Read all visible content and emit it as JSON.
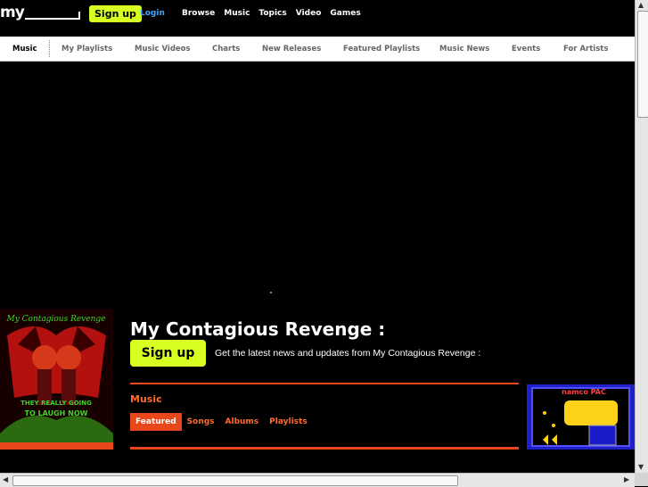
{
  "header": {
    "logo_text": "my",
    "signup_label": "Sign up",
    "login_label": "Login",
    "nav": [
      "Browse",
      "Music",
      "Topics",
      "Video",
      "Games"
    ]
  },
  "subnav": {
    "items": [
      "Music",
      "My Playlists",
      "Music Videos",
      "Charts",
      "New Releases",
      "Featured Playlists",
      "Music News",
      "Events",
      "For Artists"
    ],
    "active": "Music"
  },
  "profile": {
    "artwork_text": [
      "My Contagious Revenge",
      "THEY REALLY GOING",
      "TO LAUGH NOW"
    ],
    "title": "My Contagious Revenge :",
    "signup_label": "Sign up",
    "signup_text": "Get the latest news and updates from My Contagious Revenge :"
  },
  "music": {
    "label": "Music",
    "tabs": [
      "Featured",
      "Songs",
      "Albums",
      "Playlists"
    ],
    "active_tab": "Featured"
  },
  "ad": {
    "text": "namco PAC"
  },
  "colors": {
    "accent": "#d7ff21",
    "orange": "#e8471c",
    "link": "#3ea8ff"
  }
}
